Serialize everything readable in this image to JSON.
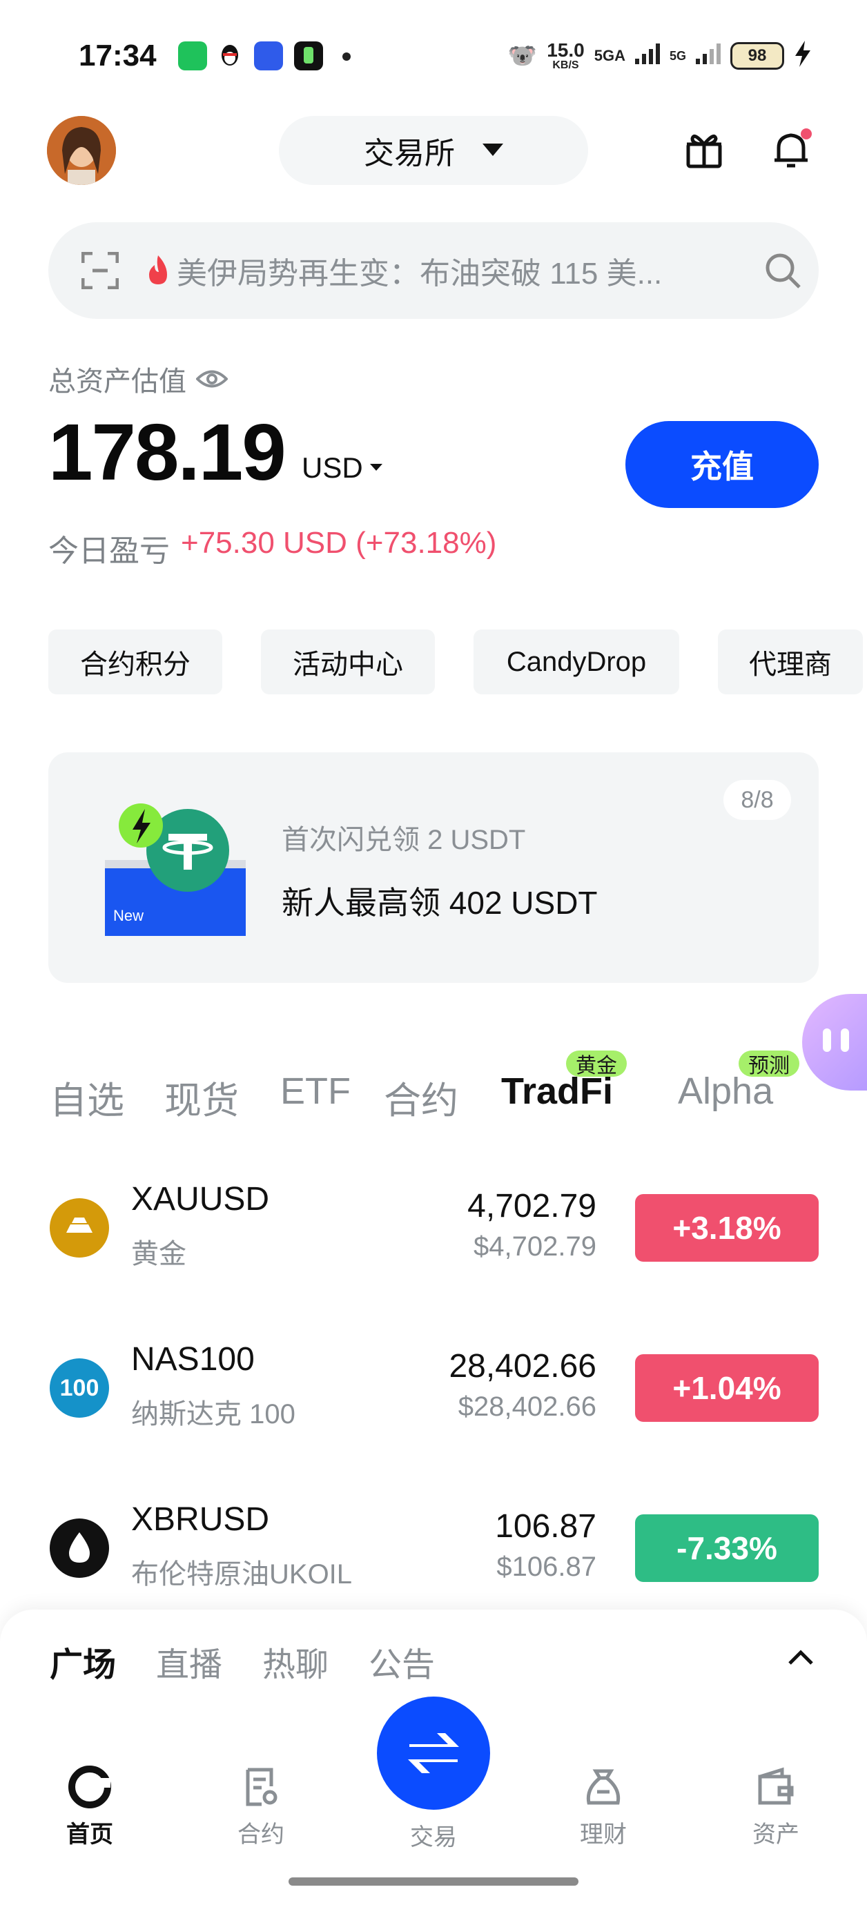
{
  "status_bar": {
    "time": "17:34",
    "net_speed": "15.0",
    "net_unit": "KB/S",
    "signal_1": "5GA",
    "signal_2": "5G",
    "battery": "98"
  },
  "header": {
    "exchange_label": "交易所",
    "icons": [
      "avatar",
      "gift-icon",
      "bell-icon"
    ]
  },
  "search": {
    "placeholder": "美伊局势再生变：布油突破 115 美..."
  },
  "assets": {
    "label": "总资产估值",
    "value": "178.19",
    "currency": "USD",
    "deposit_label": "充值",
    "pnl_label": "今日盈亏",
    "pnl_value": "+75.30 USD (+73.18%)"
  },
  "quick_chips": [
    "合约积分",
    "活动中心",
    "CandyDrop",
    "代理商"
  ],
  "promo": {
    "subtitle": "首次闪兑领 2 USDT",
    "title": "新人最高领 402 USDT",
    "page": "8/8",
    "card_tag": "New"
  },
  "market_tabs": {
    "items": [
      "自选",
      "现货",
      "ETF",
      "合约",
      "TradFi",
      "Alpha"
    ],
    "active": "TradFi",
    "badge_tradfi": "黄金",
    "badge_alpha": "预测"
  },
  "market_rows": [
    {
      "symbol": "XAUUSD",
      "name": "黄金",
      "price": "4,702.79",
      "usd": "$4,702.79",
      "change": "+3.18%",
      "change_color": "#f0506e"
    },
    {
      "symbol": "NAS100",
      "name": "纳斯达克 100",
      "price": "28,402.66",
      "usd": "$28,402.66",
      "change": "+1.04%",
      "change_color": "#f0506e",
      "icon_text": "100"
    },
    {
      "symbol": "XBRUSD",
      "name": "布伦特原油UKOIL",
      "price": "106.87",
      "usd": "$106.87",
      "change": "-7.33%",
      "change_color": "#2ebd85"
    }
  ],
  "sheet": {
    "tabs": [
      "广场",
      "直播",
      "热聊",
      "公告"
    ],
    "active": "广场"
  },
  "bottom_nav": {
    "items": [
      "首页",
      "合约",
      "交易",
      "理财",
      "资产"
    ],
    "active": "首页"
  },
  "colors": {
    "accent": "#0b4cff",
    "up": "#f0506e",
    "down": "#2ebd85",
    "badge": "#a6ef6a"
  }
}
